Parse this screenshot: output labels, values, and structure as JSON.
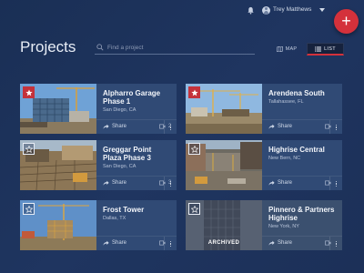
{
  "header": {
    "user_name": "Trey Matthews",
    "fab_label": "+"
  },
  "page": {
    "title": "Projects"
  },
  "search": {
    "placeholder": "Find a project"
  },
  "view_toggle": {
    "map_label": "MAP",
    "list_label": "LIST",
    "active": "list"
  },
  "colors": {
    "accent": "#d4313b",
    "background": "#1f3560",
    "card": "#304a75"
  },
  "projects": [
    {
      "title": "Alpharro Garage Phase 1",
      "location": "San Diego, CA",
      "favorite": true,
      "share_label": "Share",
      "message_count": "2",
      "archived": false
    },
    {
      "title": "Arendena South",
      "location": "Tallahassee, FL",
      "favorite": true,
      "share_label": "Share",
      "message_count": "",
      "archived": false
    },
    {
      "title": "Greggar Point Plaza Phase 3",
      "location": "San Diego, CA",
      "favorite": false,
      "share_label": "Share",
      "message_count": "3",
      "archived": false
    },
    {
      "title": "Highrise Central",
      "location": "New Bern, NC",
      "favorite": false,
      "share_label": "Share",
      "message_count": "",
      "archived": false
    },
    {
      "title": "Frost Tower",
      "location": "Dallas, TX",
      "favorite": false,
      "share_label": "Share",
      "message_count": "",
      "archived": false
    },
    {
      "title": "Pinnero & Partners Highrise",
      "location": "New York, NY",
      "favorite": false,
      "share_label": "Share",
      "message_count": "",
      "archived": true,
      "archived_label": "ARCHIVED"
    }
  ]
}
